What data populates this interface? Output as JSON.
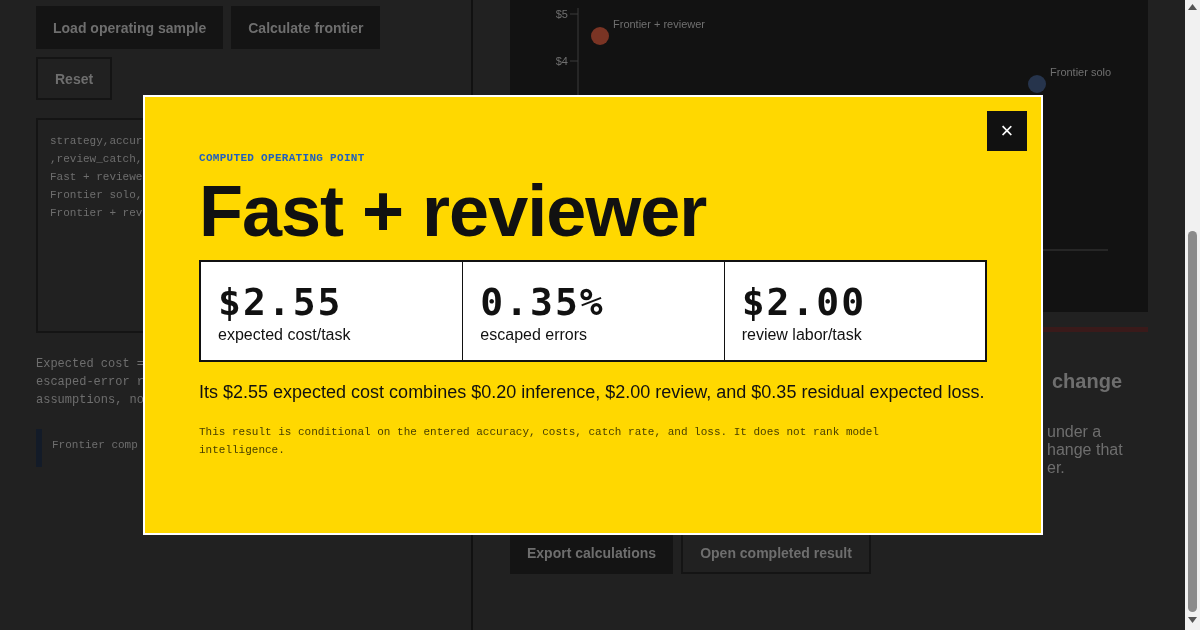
{
  "page": {
    "actions": [
      {
        "label": "Load operating sample",
        "kind": "filled"
      },
      {
        "label": "Calculate frontier",
        "kind": "filled"
      },
      {
        "label": "Reset",
        "kind": "outline"
      }
    ],
    "csv_input": {
      "lines": [
        "strategy,accur",
        ",review_catch,",
        "Fast + reviewe",
        "Frontier solo,",
        "Frontier + rev"
      ]
    },
    "method_note": {
      "lines": [
        "Expected cost =",
        "escaped-error r",
        "assumptions, no"
      ]
    },
    "callout": "Frontier comp",
    "chart": {
      "tick_labels": [
        "$5",
        "$4"
      ],
      "points": [
        {
          "label": "Frontier + reviewer",
          "color": "#7a3424"
        },
        {
          "label": "Frontier solo",
          "color": "#26344c"
        }
      ]
    },
    "section_heading": "change",
    "section_lines": [
      "under a",
      "hange that",
      "er."
    ],
    "result_actions": [
      {
        "label": "Export calculations",
        "kind": "filled"
      },
      {
        "label": "Open completed result",
        "kind": "outline"
      }
    ]
  },
  "modal": {
    "close": "×",
    "kicker": "COMPUTED OPERATING POINT",
    "title": "Fast + reviewer",
    "metrics": [
      {
        "value": "$2.55",
        "label": "expected cost/task"
      },
      {
        "value": "0.35%",
        "label": "escaped errors"
      },
      {
        "value": "$2.00",
        "label": "review labor/task"
      }
    ],
    "summary": "Its $2.55 expected cost combines $0.20 inference, $2.00 review, and $0.35 residual expected loss.",
    "note": "This result is conditional on the entered accuracy, costs, catch rate, and loss. It does not rank model intelligence."
  }
}
